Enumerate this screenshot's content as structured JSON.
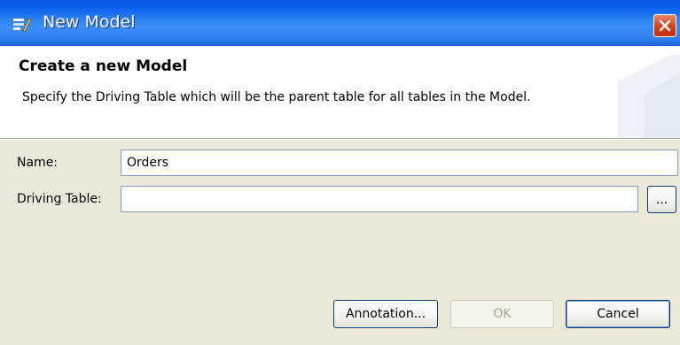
{
  "window": {
    "title": "New Model",
    "icons": {
      "app": "model-wizard-icon",
      "close": "close-icon"
    }
  },
  "header": {
    "title": "Create a new Model",
    "description": "Specify the Driving Table which will be the parent table for all tables in the Model."
  },
  "form": {
    "name_label": "Name:",
    "name_value": "Orders",
    "driving_table_label": "Driving Table:",
    "driving_table_value": "",
    "browse_label": "..."
  },
  "buttons": {
    "annotation": "Annotation...",
    "ok": "OK",
    "cancel": "Cancel"
  },
  "colors": {
    "titlebar": "#2f85f5",
    "dialog_bg": "#ece9d8",
    "close_button": "#d3401c"
  }
}
